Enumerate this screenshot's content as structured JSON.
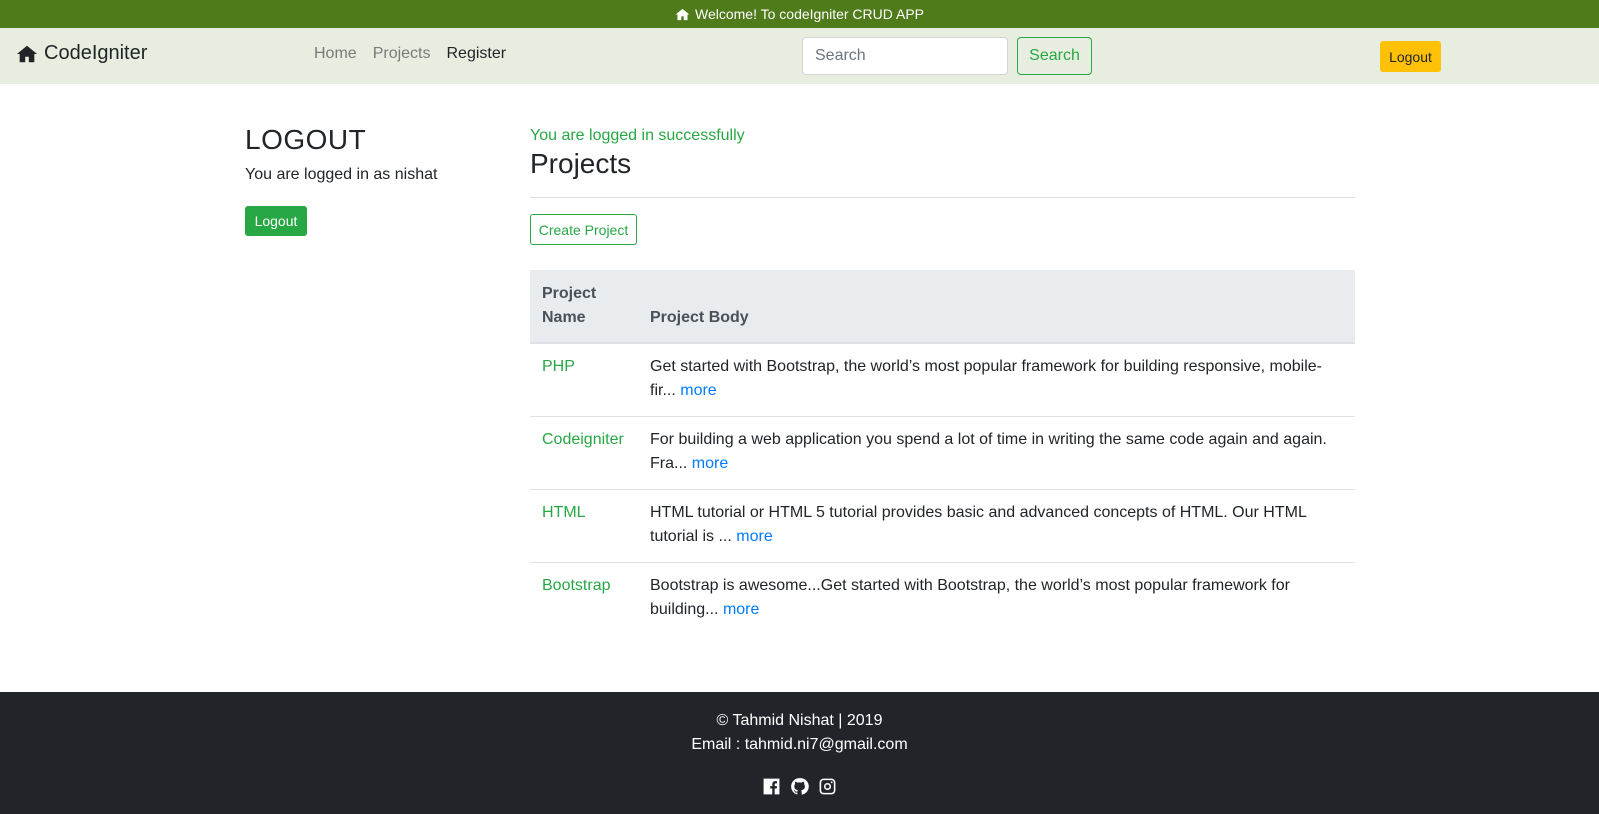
{
  "topbar": {
    "icon": "home-icon",
    "text": "Welcome! To codeIgniter CRUD APP"
  },
  "navbar": {
    "brand_icon": "home-icon",
    "brand": "CodeIgniter",
    "links": [
      "Home",
      "Projects",
      "Register"
    ],
    "search_placeholder": "Search",
    "search_button": "Search",
    "logout_button": "Logout"
  },
  "sidebar": {
    "title": "LOGOUT",
    "text": "You are logged in as nishat",
    "button": "Logout"
  },
  "main": {
    "flash": "You are logged in successfully",
    "title": "Projects",
    "create_button": "Create Project",
    "table": {
      "headers": [
        "Project Name",
        "Project Body"
      ],
      "rows": [
        {
          "name": "PHP",
          "body": "Get started with Bootstrap, the world’s most popular framework for building responsive, mobile-fir...",
          "more": "more"
        },
        {
          "name": "Codeigniter",
          "body": "For building a web application you spend a lot of time in writing the same code again and again. Fra...",
          "more": "more"
        },
        {
          "name": "HTML",
          "body": "HTML tutorial or HTML 5 tutorial provides basic and advanced concepts of HTML. Our HTML tutorial is ...",
          "more": "more"
        },
        {
          "name": "Bootstrap",
          "body": "Bootstrap is awesome...Get started with Bootstrap, the world’s most popular framework for building...",
          "more": "more"
        }
      ]
    }
  },
  "footer": {
    "line1": "© Tahmid Nishat | 2019",
    "line2": "Email : tahmid.ni7@gmail.com",
    "social_icons": [
      "facebook-icon",
      "github-icon",
      "instagram-icon"
    ]
  },
  "colors": {
    "topbar": "#4f7b1a",
    "navbar": "#e7eedf",
    "success": "#28a745",
    "warning": "#ffc107",
    "link": "#007bff",
    "footer": "#212529"
  }
}
